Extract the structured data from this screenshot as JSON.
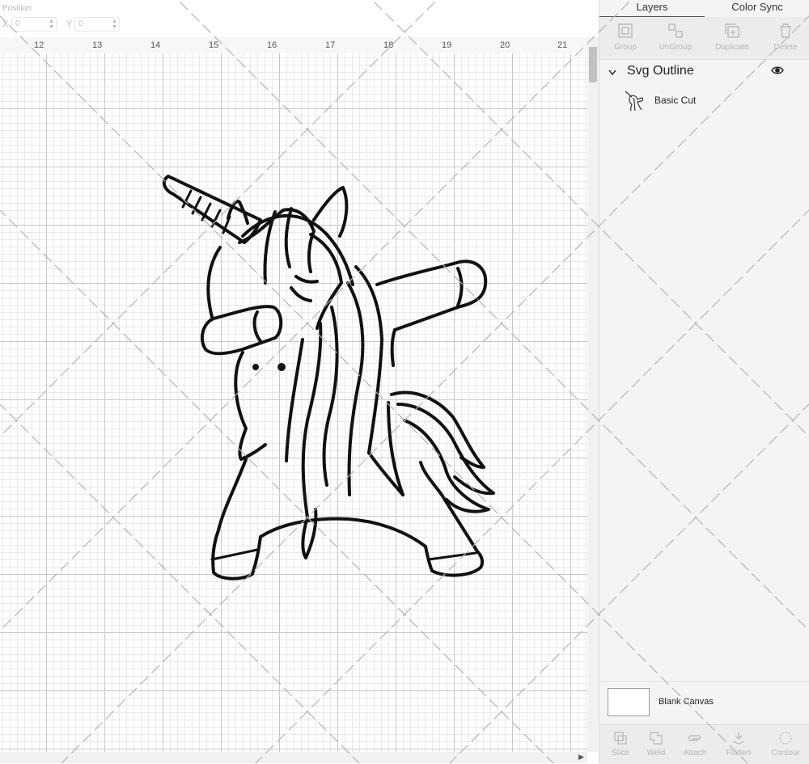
{
  "position": {
    "label": "Position",
    "x_label": "X",
    "x_value": "0",
    "y_label": "Y",
    "y_value": "0"
  },
  "ruler": {
    "ticks": [
      "12",
      "13",
      "14",
      "15",
      "16",
      "17",
      "18",
      "19",
      "20",
      "21"
    ]
  },
  "panel": {
    "tabs": [
      {
        "label": "Layers",
        "active": true
      },
      {
        "label": "Color Sync",
        "active": false
      }
    ],
    "toolbar": [
      {
        "label": "Group",
        "icon": "group-icon"
      },
      {
        "label": "UnGroup",
        "icon": "ungroup-icon"
      },
      {
        "label": "Duplicate",
        "icon": "duplicate-icon"
      },
      {
        "label": "Delete",
        "icon": "trash-icon"
      }
    ],
    "layer_group": {
      "title": "Svg Outline",
      "item": {
        "label": "Basic Cut",
        "icon": "unicorn-thumbnail"
      }
    },
    "blank_canvas": {
      "label": "Blank Canvas"
    },
    "bottom_tools": [
      {
        "label": "Slice",
        "icon": "slice-icon"
      },
      {
        "label": "Weld",
        "icon": "weld-icon"
      },
      {
        "label": "Attach",
        "icon": "paperclip-icon"
      },
      {
        "label": "Flatten",
        "icon": "flatten-icon"
      },
      {
        "label": "Contour",
        "icon": "contour-icon"
      }
    ]
  },
  "colors": {
    "canvas_bg": "#ffffff",
    "panel_bg": "#f4f4f4",
    "design_stroke": "#111111"
  }
}
